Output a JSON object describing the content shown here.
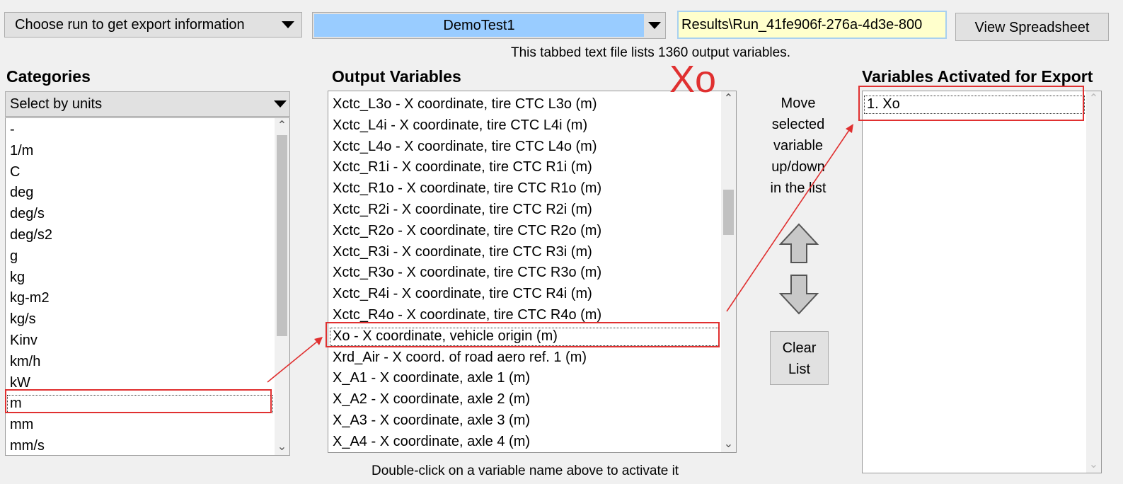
{
  "toolbar": {
    "run_select_label": "Choose run to get export information",
    "run_name": "DemoTest1",
    "results_path": "Results\\Run_41fe906f-276a-4d3e-800",
    "view_spreadsheet_label": "View Spreadsheet"
  },
  "info_text": "This tabbed text file lists 1360 output variables.",
  "categories": {
    "heading": "Categories",
    "selector": "Select by units",
    "items": [
      "-",
      "1/m",
      "C",
      "deg",
      "deg/s",
      "deg/s2",
      "g",
      "kg",
      "kg-m2",
      "kg/s",
      "Kinv",
      "km/h",
      "kW",
      "m",
      "mm",
      "mm/s"
    ],
    "selected": "m"
  },
  "output_variables": {
    "heading": "Output Variables",
    "items": [
      "Xctc_L3o - X coordinate, tire CTC L3o (m)",
      "Xctc_L4i - X coordinate, tire CTC L4i (m)",
      "Xctc_L4o - X coordinate, tire CTC L4o (m)",
      "Xctc_R1i - X coordinate, tire CTC R1i (m)",
      "Xctc_R1o - X coordinate, tire CTC R1o (m)",
      "Xctc_R2i - X coordinate, tire CTC R2i (m)",
      "Xctc_R2o - X coordinate, tire CTC R2o (m)",
      "Xctc_R3i - X coordinate, tire CTC R3i (m)",
      "Xctc_R3o - X coordinate, tire CTC R3o (m)",
      "Xctc_R4i - X coordinate, tire CTC R4i (m)",
      "Xctc_R4o - X coordinate, tire CTC R4o (m)",
      "Xo - X coordinate, vehicle origin (m)",
      "Xrd_Air - X coord. of road aero ref. 1 (m)",
      "X_A1 - X coordinate, axle 1 (m)",
      "X_A2 - X coordinate, axle 2 (m)",
      "X_A3 - X coordinate, axle 3 (m)",
      "X_A4 - X coordinate, axle 4 (m)"
    ],
    "selected": "Xo - X coordinate, vehicle origin (m)"
  },
  "annotation_label": "Xo",
  "move_controls": {
    "label_lines": [
      "Move",
      "selected",
      "variable",
      "up/down",
      "in the list"
    ],
    "up_icon": "up-arrow-icon",
    "down_icon": "down-arrow-icon",
    "clear_line1": "Clear",
    "clear_line2": "List"
  },
  "activated": {
    "heading": "Variables Activated for Export",
    "items": [
      "1. Xo"
    ]
  },
  "footer_text": "Double-click on a variable name above to activate it",
  "colors": {
    "run_highlight": "#99ccff",
    "path_field": "#ffffcc",
    "annotation_red": "#e03030"
  }
}
